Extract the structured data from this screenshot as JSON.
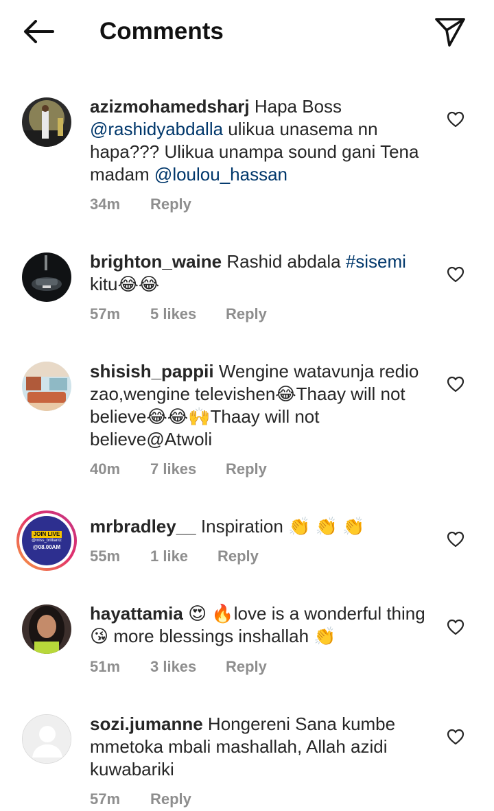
{
  "header": {
    "title": "Comments"
  },
  "comments": [
    {
      "username": "azizmohamedsharj",
      "parts": [
        {
          "t": " Hapa Boss ",
          "link": false
        },
        {
          "t": "@rashidyabdalla",
          "link": true
        },
        {
          "t": "  ulikua unasema nn hapa??? Ulikua unampa sound gani Tena madam ",
          "link": false
        },
        {
          "t": "@loulou_hassan",
          "link": true
        }
      ],
      "time": "34m",
      "likes": "",
      "reply": "Reply"
    },
    {
      "username": "brighton_waine",
      "parts": [
        {
          "t": " Rashid abdala ",
          "link": false
        },
        {
          "t": "#sisemi",
          "link": true
        },
        {
          "t": " kitu😂😂",
          "link": false
        }
      ],
      "time": "57m",
      "likes": "5 likes",
      "reply": "Reply"
    },
    {
      "username": "shisish_pappii",
      "parts": [
        {
          "t": " Wengine watavunja redio zao,wengine televishen😂Thaay will not believe😂😂🙌Thaay will not believe@Atwoli",
          "link": false
        }
      ],
      "time": "40m",
      "likes": "7 likes",
      "reply": "Reply"
    },
    {
      "username": "mrbradley__",
      "parts": [
        {
          "t": " Inspiration 👏 👏 👏",
          "link": false
        }
      ],
      "time": "55m",
      "likes": "1 like",
      "reply": "Reply",
      "avatar_text": {
        "line1": "JOIN LIVE",
        "line2": "@miss_brilliantz",
        "line3": "@08.00AM"
      }
    },
    {
      "username": "hayattamia",
      "parts": [
        {
          "t": " 😍 🔥love is a wonderful thing 😘 more blessings inshallah 👏",
          "link": false
        }
      ],
      "time": "51m",
      "likes": "3 likes",
      "reply": "Reply"
    },
    {
      "username": "sozi.jumanne",
      "parts": [
        {
          "t": " Hongereni Sana kumbe mmetoka mbali mashallah, Allah azidi kuwabariki",
          "link": false
        }
      ],
      "time": "57m",
      "likes": "",
      "reply": "Reply"
    }
  ],
  "icons": {
    "back": "arrow-left-icon",
    "send": "paper-plane-icon",
    "like": "heart-outline-icon"
  },
  "colors": {
    "text": "#262626",
    "link": "#00376b",
    "meta": "#8e8e8e",
    "story_ring_start": "#f9a03f",
    "story_ring_end": "#c13584"
  }
}
